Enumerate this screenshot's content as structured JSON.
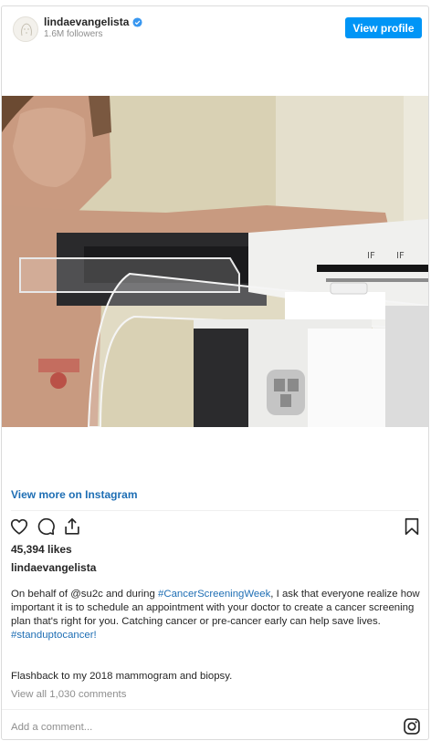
{
  "header": {
    "username": "lindaevangelista",
    "followers": "1.6M followers",
    "view_profile": "View profile"
  },
  "media": {
    "mammogram_brand_marks": [
      "IF",
      "IF"
    ]
  },
  "links": {
    "view_more": "View more on Instagram"
  },
  "post": {
    "likes": "45,394 likes",
    "caption_user": "lindaevangelista",
    "caption_part1": "On behalf of @su2c and during ",
    "caption_hashtag1": "#CancerScreeningWeek",
    "caption_part2": ", I ask that everyone realize how important it is to schedule an appointment with your doctor to create a cancer screening plan that's right for you. Catching cancer or pre-cancer early can help save lives.",
    "caption_hashtag2": "#standuptocancer!",
    "flashback": "Flashback to my 2018 mammogram and biopsy.",
    "view_comments": "View all 1,030 comments"
  },
  "comment_box": {
    "placeholder": "Add a comment..."
  },
  "icons": {
    "verified": "verified-badge-icon",
    "like": "heart-icon",
    "comment": "comment-icon",
    "share": "share-icon",
    "save": "bookmark-icon",
    "instagram": "instagram-logo-icon"
  },
  "colors": {
    "accent": "#0095f6",
    "link": "#1e6eb4",
    "muted": "#8e8e8e"
  }
}
